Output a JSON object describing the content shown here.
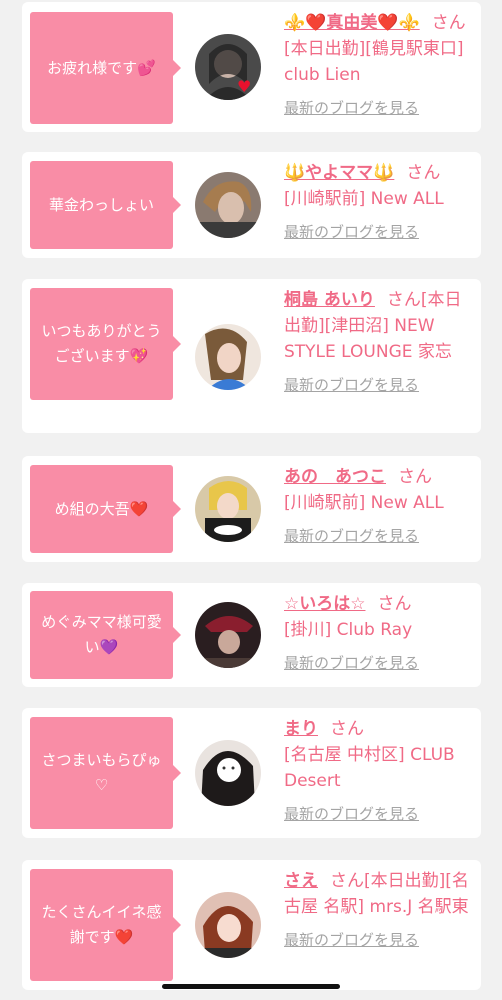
{
  "items": [
    {
      "message": "お疲れ様です💕",
      "name": "⚜️❤️真由美❤️⚜️",
      "san": "さん",
      "detail": "[本日出勤][鶴見駅東口] club Lien",
      "blog": "最新のブログを見る"
    },
    {
      "message": "華金わっしょい",
      "name": "🔱やよママ🔱",
      "san": "さん",
      "detail": "[川崎駅前] New ALL",
      "blog": "最新のブログを見る"
    },
    {
      "message": "いつもありがとうございます💖",
      "name": "桐島 あいり",
      "san": "さん",
      "detail": "[本日出勤][津田沼] NEW STYLE LOUNGE 家忘",
      "blog": "最新のブログを見る"
    },
    {
      "message": "め組の大吾❤️",
      "name": "あの　あつこ",
      "san": "さん",
      "detail": "[川崎駅前] New ALL",
      "blog": "最新のブログを見る"
    },
    {
      "message": "めぐみママ様可愛い💜",
      "name": "☆いろは☆",
      "san": "さん",
      "detail": "[掛川] Club Ray",
      "blog": "最新のブログを見る"
    },
    {
      "message": "さつまいもらぴゅ♡",
      "name": "まり",
      "san": "さん",
      "detail": "[名古屋 中村区] CLUB Desert",
      "blog": "最新のブログを見る"
    },
    {
      "message": "たくさんイイネ感謝です❤️",
      "name": "さえ",
      "san": "さん",
      "detail": "[本日出勤][名古屋 名駅] mrs.J 名駅東",
      "blog": "最新のブログを見る"
    }
  ],
  "colors": {
    "accent": "#f98da6",
    "link": "#f06a86",
    "muted": "#a4a4a4"
  }
}
